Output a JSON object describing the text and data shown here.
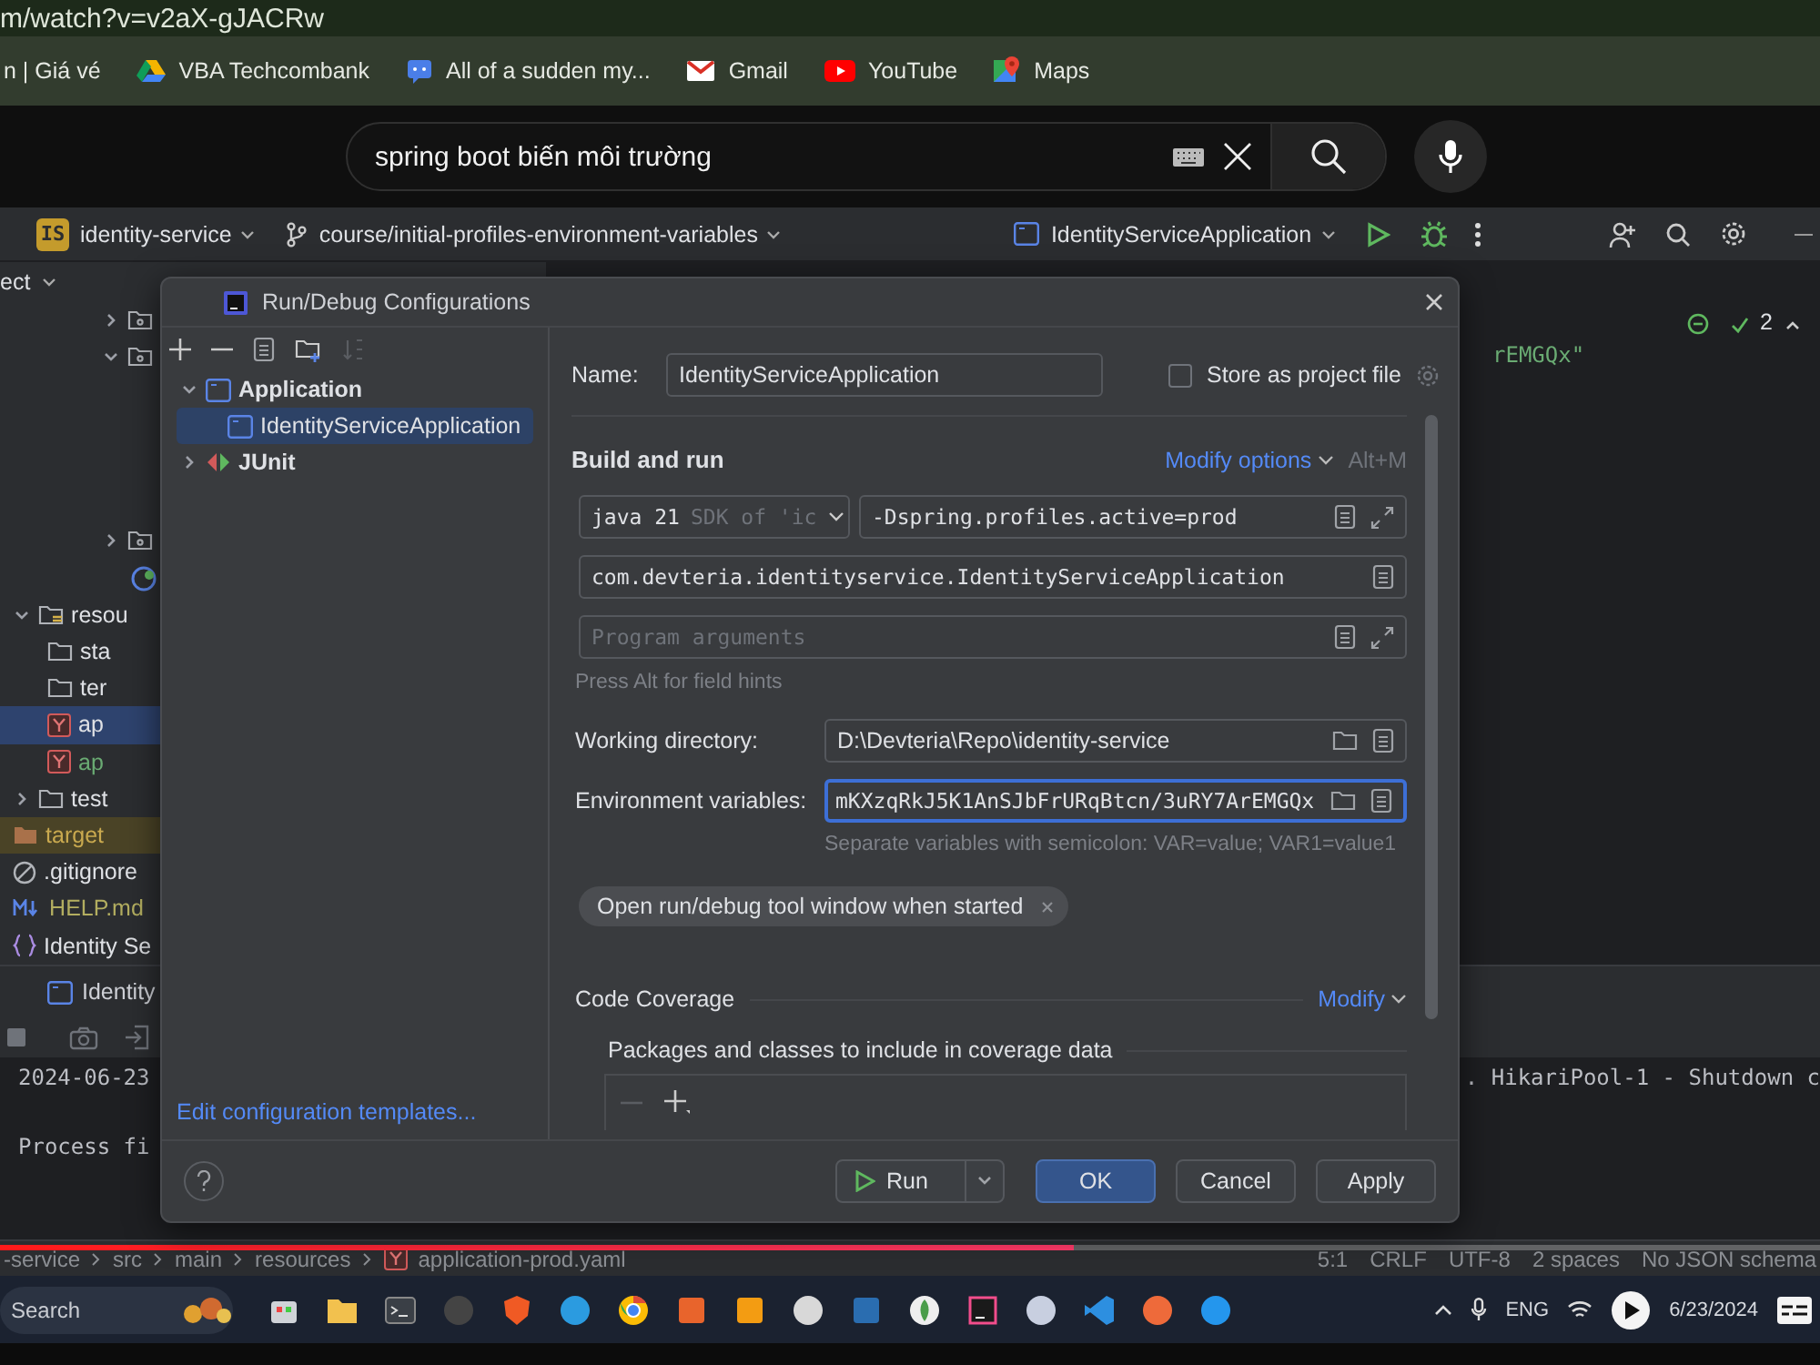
{
  "browser": {
    "url": "m/watch?v=v2aX-gJACRw",
    "bookmarks": [
      {
        "label": "n | Giá vé"
      },
      {
        "label": "VBA Techcombank"
      },
      {
        "label": "All of a sudden my..."
      },
      {
        "label": "Gmail"
      },
      {
        "label": "YouTube"
      },
      {
        "label": "Maps"
      }
    ]
  },
  "video_search": {
    "value": "spring boot biến môi trường"
  },
  "ide_toolbar": {
    "project_badge": "IS",
    "project": "identity-service",
    "branch": "course/initial-profiles-environment-variables",
    "run_configuration": "IdentityServiceApplication"
  },
  "project_tree": {
    "header": "ect",
    "upper_rows": [
      {
        "kind": "folder",
        "expanded": false
      },
      {
        "kind": "folder",
        "expanded": true
      },
      {
        "kind": "folder",
        "expanded": false
      },
      {
        "kind": "spring"
      }
    ],
    "items": [
      {
        "label": "resou",
        "kind": "resources",
        "expanded": true,
        "selected": false,
        "children": [
          {
            "label": "sta",
            "kind": "folder",
            "selected": false
          },
          {
            "label": "ter",
            "kind": "folder",
            "selected": false
          },
          {
            "label": "ap",
            "kind": "yaml",
            "selected": true
          },
          {
            "label": "ap",
            "kind": "yaml",
            "selected": false,
            "color": "#6aab73"
          }
        ]
      },
      {
        "label": "test",
        "kind": "folder",
        "expanded": false,
        "selected": false
      },
      {
        "label": "target",
        "kind": "folder-filled",
        "selected": false,
        "excluded": true,
        "color": "#c9a94f"
      },
      {
        "label": ".gitignore",
        "kind": "ignore",
        "selected": false
      },
      {
        "label": "HELP.md",
        "kind": "markdown",
        "selected": false,
        "color": "#b3ae60"
      },
      {
        "label": "Identity Se",
        "kind": "json",
        "selected": false
      }
    ]
  },
  "editor": {
    "snippet": "rEMGQx\"",
    "problems_count": "2"
  },
  "run_panel": {
    "tab": "Identity",
    "console": [
      {
        "text": "2024-06-23"
      },
      {
        "text": "Process fi"
      }
    ],
    "console_right": ". HikariPool-1 - Shutdown c"
  },
  "dialog": {
    "title": "Run/Debug Configurations",
    "tree": [
      {
        "label": "Application",
        "expanded": true,
        "selected": false,
        "children": [
          {
            "label": "IdentityServiceApplication",
            "selected": true
          }
        ]
      },
      {
        "label": "JUnit",
        "expanded": false,
        "selected": false
      }
    ],
    "templates_link": "Edit configuration templates...",
    "name_label": "Name:",
    "name_value": "IdentityServiceApplication",
    "store_label": "Store as project file",
    "store_checked": false,
    "section": "Build and run",
    "modify_options": "Modify options",
    "shortcut": "Alt+M",
    "jdk": "java 21",
    "jdk_hint": "SDK of 'ic",
    "vm_options": "-Dspring.profiles.active=prod",
    "main_class": "com.devteria.identityservice.IdentityServiceApplication",
    "args_placeholder": "Program arguments",
    "field_hint": "Press Alt for field hints",
    "workdir_label": "Working directory:",
    "workdir": "D:\\Devteria\\Repo\\identity-service",
    "env_label": "Environment variables:",
    "env": "mKXzqRkJ5K1AnSJbFrURqBtcn/3uRY7ArEMGQx",
    "env_hint": "Separate variables with semicolon: VAR=value; VAR1=value1",
    "chip": "Open run/debug tool window when started",
    "coverage": "Code Coverage",
    "coverage_modify": "Modify",
    "packages_label": "Packages and classes to include in coverage data",
    "buttons": [
      {
        "label": "Run",
        "kind": "split"
      },
      {
        "label": "OK",
        "kind": "default"
      },
      {
        "label": "Cancel",
        "kind": "plain"
      },
      {
        "label": "Apply",
        "kind": "plain"
      }
    ]
  },
  "status_bar": {
    "breadcrumbs": [
      "-service",
      "src",
      "main",
      "resources",
      "application-prod.yaml"
    ],
    "items": [
      "5:1",
      "CRLF",
      "UTF-8",
      "2 spaces",
      "No JSON schema"
    ]
  },
  "video": {
    "progress": {
      "level": 0.59
    }
  },
  "taskbar": {
    "search_placeholder": "Search",
    "language": "ENG",
    "date": "6/23/2024"
  }
}
